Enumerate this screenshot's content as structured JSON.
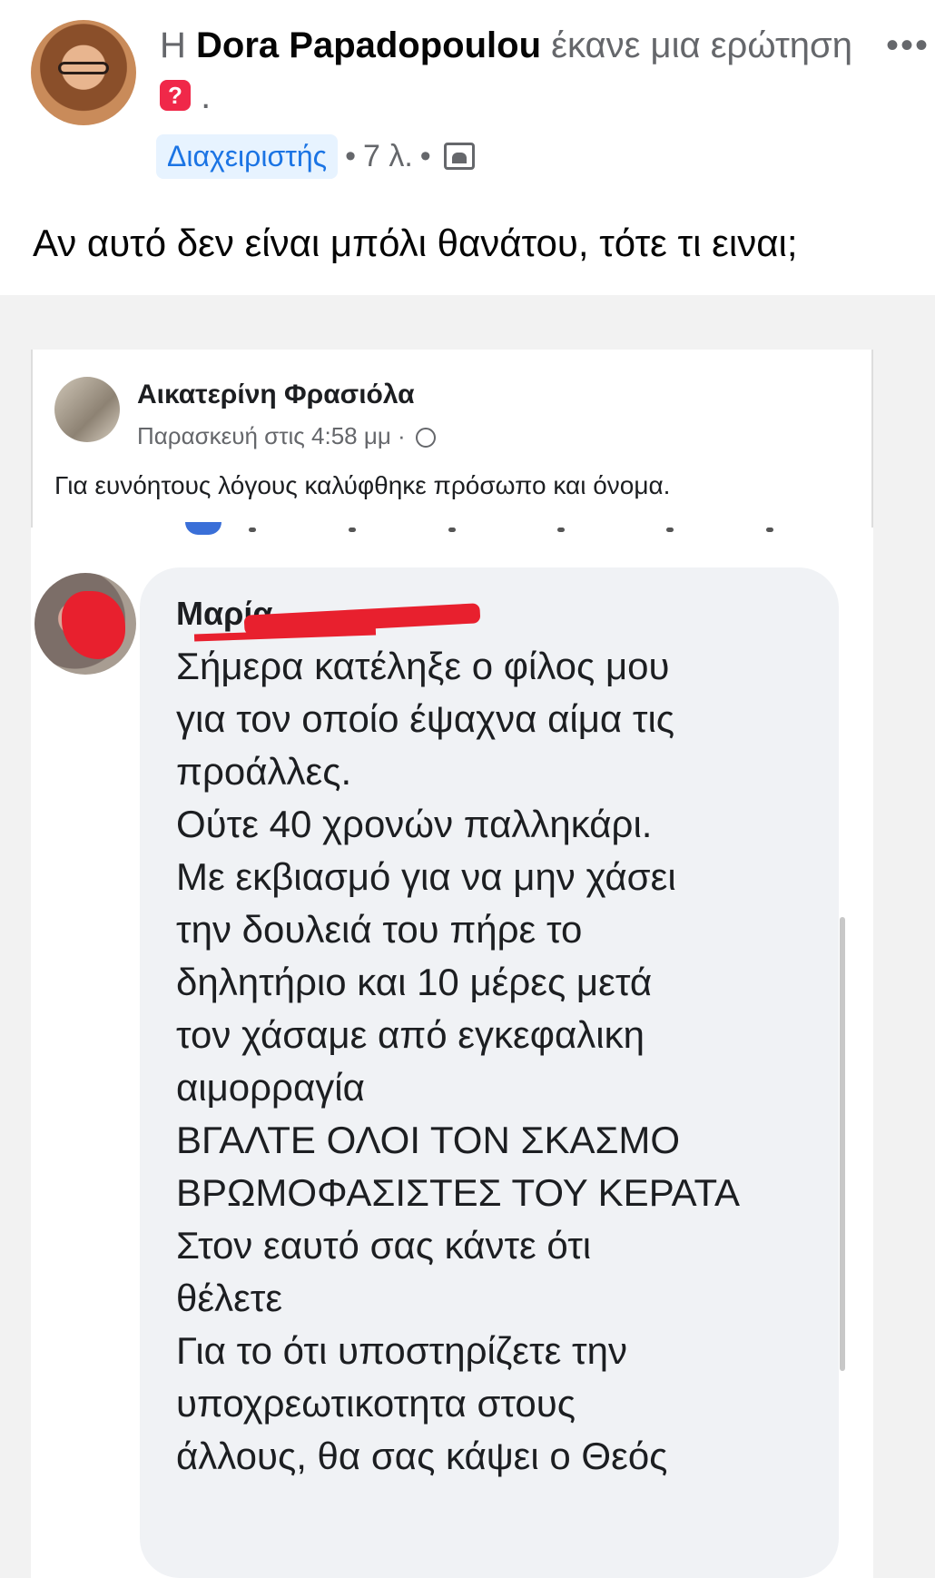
{
  "post": {
    "author_prefix": "Η",
    "author_name": "Dora Papadopoulou",
    "action_text": "έκανε μια ερώτηση",
    "action_suffix": ".",
    "question_icon": "question-mark-icon",
    "badge": "Διαχειριστής",
    "time": "7 λ.",
    "more": "•••",
    "text": "Αν αυτό δεν είναι μπόλι θανάτου, τότε τι ειναι;"
  },
  "shared_card": {
    "name": "Αικατερίνη Φρασιόλα",
    "timestamp": "Παρασκευή στις 4:58 μμ ·",
    "note": "Για ευνόητους λόγους καλύφθηκε πρόσωπο και όνομα."
  },
  "comment": {
    "name": "Μαρία",
    "lines": [
      "Σήμερα κατέληξε ο φίλος μου",
      "για τον οποίο έψαχνα αίμα τις",
      "προάλλες.",
      "Ούτε 40 χρονών παλληκάρι.",
      "Με εκβιασμό για να μην χάσει",
      "την δουλειά του πήρε το",
      "δηλητήριο και 10 μέρες μετά",
      "τον χάσαμε από εγκεφαλικη",
      "αιμορραγία",
      "ΒΓΑΛΤΕ ΟΛΟΙ ΤΟΝ ΣΚΑΣΜΟ",
      "ΒΡΩΜΟΦΑΣΙΣΤΕΣ ΤΟΥ ΚΕΡΑΤΑ",
      "Στον εαυτό σας κάντε ότι",
      "θέλετε",
      "Για το ότι υποστηρίζετε την",
      "υποχρεωτικοτητα στους",
      "άλλους, θα σας κάψει ο Θεός"
    ]
  },
  "colors": {
    "link_blue": "#1b74e4",
    "badge_bg": "#e7f3ff",
    "redaction": "#e8202e"
  }
}
